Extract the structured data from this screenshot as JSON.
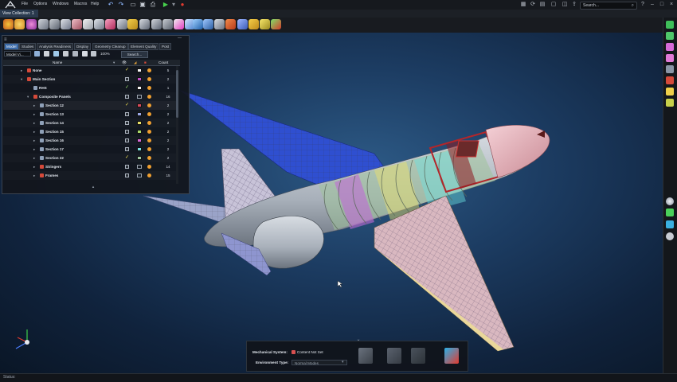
{
  "menu": {
    "items": [
      "File",
      "Options",
      "Windows",
      "Macros",
      "Help"
    ]
  },
  "search": {
    "placeholder": "Search..."
  },
  "view": {
    "tab_label": "View Collection: 1"
  },
  "panel": {
    "tabs": [
      "Model",
      "Studies",
      "Analysis Readiness",
      "Display",
      "Geometry Cleanup",
      "Element Quality",
      "Post"
    ],
    "model_selector": "Model Vi...",
    "zoom": "100%",
    "search_label": "Search...",
    "columns": {
      "name": "Name",
      "count": "Count"
    },
    "rows": [
      {
        "name": "None",
        "count": "5"
      },
      {
        "name": "Main Section",
        "count": "2"
      },
      {
        "name": "RHS",
        "count": "1"
      },
      {
        "name": "Composite Panels",
        "count": "16"
      },
      {
        "name": "Section 12",
        "count": "2"
      },
      {
        "name": "Section 13",
        "count": "2"
      },
      {
        "name": "Section 14",
        "count": "2"
      },
      {
        "name": "Section 15",
        "count": "2"
      },
      {
        "name": "Section 16",
        "count": "2"
      },
      {
        "name": "Section 17",
        "count": "2"
      },
      {
        "name": "Section 22",
        "count": "2"
      },
      {
        "name": "Stringers",
        "count": "14"
      },
      {
        "name": "Frames",
        "count": "15"
      }
    ]
  },
  "mechanical": {
    "system_label": "Mechanical System:",
    "system_value": "Content Not Set",
    "env_label": "Environment Type:",
    "env_value": "Normal Modes"
  },
  "status": {
    "text": "Status:"
  },
  "colors": {
    "accent": "#3a6aa8",
    "viewport_center": "#2d5a86",
    "wing_blue": "#2f4fd0",
    "nose_pink": "#e9b7bf",
    "fuselage_grey": "#a8b0ba"
  },
  "icons": {
    "app_logo": "altair-logo-icon",
    "run": "play-icon",
    "record": "record-icon",
    "undo": "undo-icon",
    "redo": "redo-icon"
  }
}
